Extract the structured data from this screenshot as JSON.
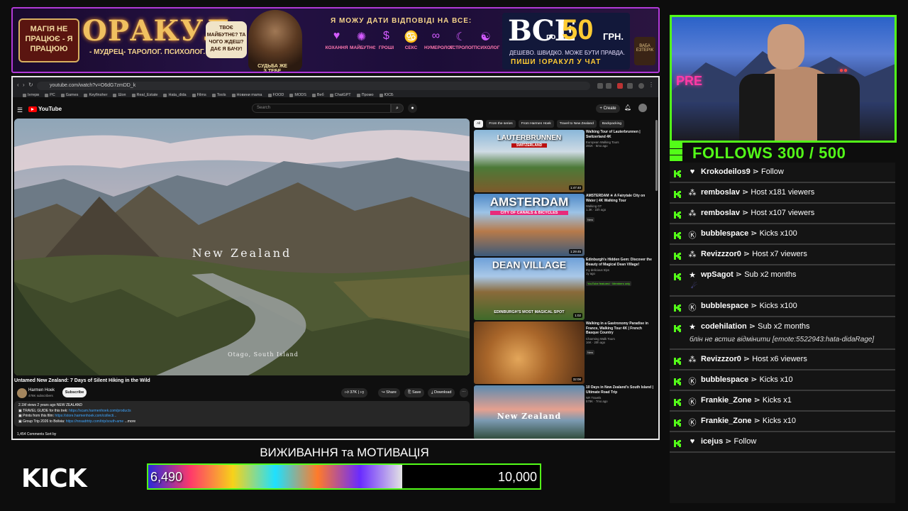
{
  "banner": {
    "badge": "МАГІЯ НЕ ПРАЦЮЄ - Я ПРАЦЮЮ",
    "title": "ОРАКУЛ",
    "subtitle": "- МУДРЕЦ- ТАРОЛОГ. ПСИХОЛОГ. -",
    "bubble": "ТВОЄ МАЙБУТНЄ? ТА ЧОГО ЖДЕШ? ДАЄ Я БАЧУ!",
    "wizard_tag": "СУДЬБА ЖЕ З ТЕБЕ",
    "topline": "Я МОЖУ ДАТИ ВІДПОВІДІ НА ВСЕ:",
    "categories": [
      {
        "icon": "♥",
        "label": "КОХАННЯ"
      },
      {
        "icon": "✺",
        "label": "МАЙБУТНЄ"
      },
      {
        "icon": "$",
        "label": "ГРОШІ"
      },
      {
        "icon": "♋",
        "label": "СЕКС"
      },
      {
        "icon": "∞",
        "label": "НУМЕРОЛОГ"
      },
      {
        "icon": "☾",
        "label": "АСТРОЛОГ"
      },
      {
        "icon": "☯",
        "label": "ПСИХОЛОГ"
      }
    ],
    "price_big": "ВСЕ",
    "price_prefix": "по",
    "price_number": "50",
    "price_currency": "ГРН.",
    "price_line1": "ДЕШЕВО. ШВИДКО. МОЖЕ БУТИ ПРАВДА.",
    "price_line2": "ПИШИ !ОРАКУЛ У ЧАТ",
    "mug": "ВАБА ЕЗТЕРІК"
  },
  "browser": {
    "url": "youtube.com/watch?v=O6dG7zmDD_k",
    "bookmarks": [
      "Інтерв",
      "PC",
      "Games",
      "Keyfinsher",
      "Шоп",
      "Real_Estate",
      "Hata_dida",
      "Films",
      "Tools",
      "Новини mama",
      "FOOD",
      "MODS",
      "Веб",
      "ChatGPT",
      "Промо",
      "ЮСБ"
    ]
  },
  "youtube": {
    "logo": "YouTube",
    "search_placeholder": "Search",
    "create_label": "+ Create",
    "video": {
      "overlay_title": "New Zealand",
      "overlay_sub": "Otago, South Island",
      "title": "Untamed New Zealand: 7 Days of Silent Hiking in the Wild",
      "channel": "Harmen Hoek",
      "subscribers": "478K subscribers",
      "subscribe": "Subscribe",
      "likes": "37K",
      "share": "Share",
      "save": "Save",
      "download": "Download",
      "views_line": "2.1M views  2 years ago  NEW ZEALAND",
      "desc1_label": "TRAVEL GUIDE for this trek:",
      "desc1_link": "https://scam.harmenhoek.com/products",
      "desc2_label": "Prints from this film:",
      "desc2_link": "https://store.harmenhoek.com/collecti...",
      "desc3_label": "Group Trip 2026 to Bolivia:",
      "desc3_link": "https://nnsadrtrip.com/trip/south-ame",
      "more": "...more",
      "comments": "1,454 Comments      Sort by"
    },
    "chips": [
      "All",
      "From the series",
      "From Harmen Hoek",
      "Travel to New Zealand",
      "Backpacking"
    ],
    "recs": [
      {
        "thumb": "LAUTERBRUNNEN",
        "thumb_sub": "SWITZERLAND",
        "duration": "1:47:40",
        "title": "Walking Tour of Lauterbrunnen | Switzerland 4K",
        "channel": "European Walking Tours",
        "meta": "281K · 5mo ago",
        "badge": ""
      },
      {
        "thumb": "AMSTERDAM",
        "thumb_sub": "CITY OF CANALS & BICYCLES",
        "duration": "1:29:45",
        "title": "AMSTERDAM ☀ A Fairytale City on Water | 4K Walking Tour",
        "channel": "Walking GT",
        "meta": "1.3K · 22h ago",
        "badge": "New"
      },
      {
        "thumb": "DEAN VILLAGE",
        "thumb_sub": "EDINBURGH'S MOST MAGICAL SPOT",
        "duration": "1:02",
        "title": "Edinburgh's Hidden Gem: Discover the Beauty of Magical Dean Village!",
        "channel": "my delicious trips",
        "meta": "1y ago",
        "badge": "YouTube featured · Members only"
      },
      {
        "thumb": "",
        "thumb_sub": "",
        "duration": "32:08",
        "title": "Walking in a Gastronomy Paradise in France, Walking Tour 4K | French Basque Country",
        "channel": "Charming Walk Tours",
        "meta": "16K · 20h ago",
        "badge": "New"
      },
      {
        "thumb": "New Zealand",
        "thumb_sub": "",
        "duration": "",
        "title": "10 Days in New Zealand's South Island | Ultimate Road Trip",
        "channel": "NR Travels",
        "meta": "578K · 7mo ago",
        "badge": ""
      }
    ]
  },
  "follows_goal": "FOLLOWS 300 / 500",
  "events": [
    {
      "type": "follow",
      "user": "Krokodeilos9",
      "action": "Follow",
      "extra": ""
    },
    {
      "type": "host",
      "user": "remboslav",
      "action": "Host x181 viewers",
      "extra": ""
    },
    {
      "type": "host",
      "user": "remboslav",
      "action": "Host x107 viewers",
      "extra": ""
    },
    {
      "type": "kicks",
      "user": "bubblespace",
      "action": "Kicks x100",
      "extra": ""
    },
    {
      "type": "host",
      "user": "Revizzzor0",
      "action": "Host x7 viewers",
      "extra": ""
    },
    {
      "type": "sub",
      "user": "wpSagot",
      "action": "Sub x2 months",
      "extra": "",
      "emote": "☄"
    },
    {
      "type": "kicks",
      "user": "bubblespace",
      "action": "Kicks x100",
      "extra": ""
    },
    {
      "type": "sub",
      "user": "codehilation",
      "action": "Sub x2 months",
      "extra": "блін не встиг відмінити [emote:5522943:hata-didaRage]"
    },
    {
      "type": "host",
      "user": "Revizzzor0",
      "action": "Host x6 viewers",
      "extra": ""
    },
    {
      "type": "kicks",
      "user": "bubblespace",
      "action": "Kicks x10",
      "extra": ""
    },
    {
      "type": "kicks",
      "user": "Frankie_Zone",
      "action": "Kicks x1",
      "extra": ""
    },
    {
      "type": "kicks",
      "user": "Frankie_Zone",
      "action": "Kicks x10",
      "extra": ""
    },
    {
      "type": "follow",
      "user": "icejus",
      "action": "Follow",
      "extra": ""
    }
  ],
  "kick_logo": "KICK",
  "motivation": {
    "title": "ВИЖИВАННЯ та МОТИВАЦІЯ",
    "current": "6,490",
    "goal": "10,000",
    "progress": 0.649
  },
  "colors": {
    "kick_green": "#53fc18",
    "banner_border": "#b23ad8"
  }
}
